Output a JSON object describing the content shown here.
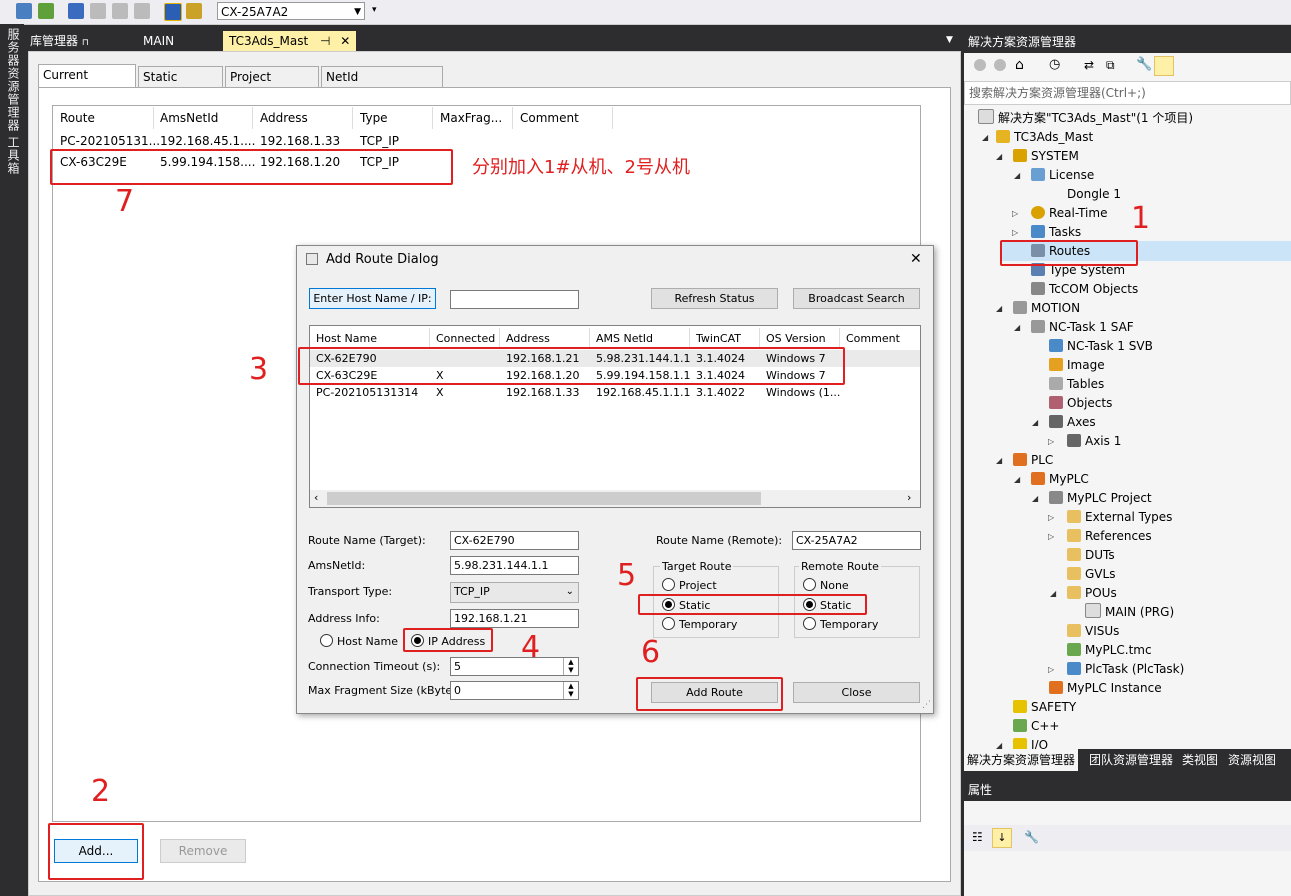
{
  "toolbar": {
    "target_combo": "CX-25A7A2"
  },
  "left_strip": {
    "items": [
      "服务器资源管理器",
      "工具箱"
    ]
  },
  "doc_tabs": {
    "tab1": "库管理器",
    "tab2": "MAIN",
    "tab3": "TC3Ads_Mast",
    "tab3_pin": "⊣",
    "tab3_close": "✕"
  },
  "route_tabs": [
    "Current Routes",
    "Static Routes",
    "Project Routes",
    "NetId Management"
  ],
  "routes_table": {
    "columns": [
      "Route",
      "AmsNetId",
      "Address",
      "Type",
      "MaxFrag...",
      "Comment"
    ],
    "rows": [
      [
        "PC-202105131...",
        "192.168.45.1....",
        "192.168.1.33",
        "TCP_IP"
      ],
      [
        "CX-63C29E",
        "5.99.194.158....",
        "192.168.1.20",
        "TCP_IP"
      ]
    ]
  },
  "annotation_text": "分别加入1#从机、2号从机",
  "annotation_numbers": [
    "1",
    "2",
    "3",
    "4",
    "5",
    "6",
    "7"
  ],
  "buttons": {
    "add": "Add...",
    "remove": "Remove"
  },
  "dialog": {
    "title": "Add Route Dialog",
    "close": "✕",
    "enter_host_btn": "Enter Host Name / IP:",
    "host_input": "",
    "refresh_btn": "Refresh Status",
    "broadcast_btn": "Broadcast Search",
    "host_columns": [
      "Host Name",
      "Connected",
      "Address",
      "AMS NetId",
      "TwinCAT",
      "OS Version",
      "Comment"
    ],
    "hosts": [
      [
        "CX-62E790",
        "",
        "192.168.1.21",
        "5.98.231.144.1.1",
        "3.1.4024",
        "Windows 7"
      ],
      [
        "CX-63C29E",
        "X",
        "192.168.1.20",
        "5.99.194.158.1.1",
        "3.1.4024",
        "Windows 7"
      ],
      [
        "PC-202105131314",
        "X",
        "192.168.1.33",
        "192.168.45.1.1.1",
        "3.1.4022",
        "Windows (1..."
      ]
    ],
    "route_name_target_label": "Route Name (Target):",
    "route_name_target": "CX-62E790",
    "amsnetid_label": "AmsNetId:",
    "amsnetid": "5.98.231.144.1.1",
    "transport_label": "Transport Type:",
    "transport": "TCP_IP",
    "address_info_label": "Address Info:",
    "address_info": "192.168.1.21",
    "host_name_radio": "Host Name",
    "ip_address_radio": "IP Address",
    "timeout_label": "Connection Timeout (s):",
    "timeout": "5",
    "max_frag_label": "Max Fragment Size (kByte):",
    "max_frag": "0",
    "route_name_remote_label": "Route Name (Remote):",
    "route_name_remote": "CX-25A7A2",
    "target_route_title": "Target Route",
    "target_route_options": [
      "Project",
      "Static",
      "Temporary"
    ],
    "remote_route_title": "Remote Route",
    "remote_route_options": [
      "None",
      "Static",
      "Temporary"
    ],
    "add_route_btn": "Add Route",
    "close_btn": "Close"
  },
  "solution_explorer": {
    "title": "解决方案资源管理器",
    "search_placeholder": "搜索解决方案资源管理器(Ctrl+;)",
    "tree": [
      "解决方案\"TC3Ads_Mast\"(1 个项目)",
      "TC3Ads_Mast",
      "SYSTEM",
      "License",
      "Dongle 1",
      "Real-Time",
      "Tasks",
      "Routes",
      "Type System",
      "TcCOM Objects",
      "MOTION",
      "NC-Task 1 SAF",
      "NC-Task 1 SVB",
      "Image",
      "Tables",
      "Objects",
      "Axes",
      "Axis 1",
      "PLC",
      "MyPLC",
      "MyPLC Project",
      "External Types",
      "References",
      "DUTs",
      "GVLs",
      "POUs",
      "MAIN (PRG)",
      "VISUs",
      "MyPLC.tmc",
      "PlcTask (PlcTask)",
      "MyPLC Instance",
      "SAFETY",
      "C++",
      "I/O"
    ],
    "bottom_tabs": [
      "解决方案资源管理器",
      "团队资源管理器",
      "类视图",
      "资源视图"
    ],
    "properties_title": "属性"
  },
  "colors": {
    "annotation_red": "#e02020",
    "selected_tab": "#fff0a8",
    "dark_chrome": "#2d2d30"
  }
}
